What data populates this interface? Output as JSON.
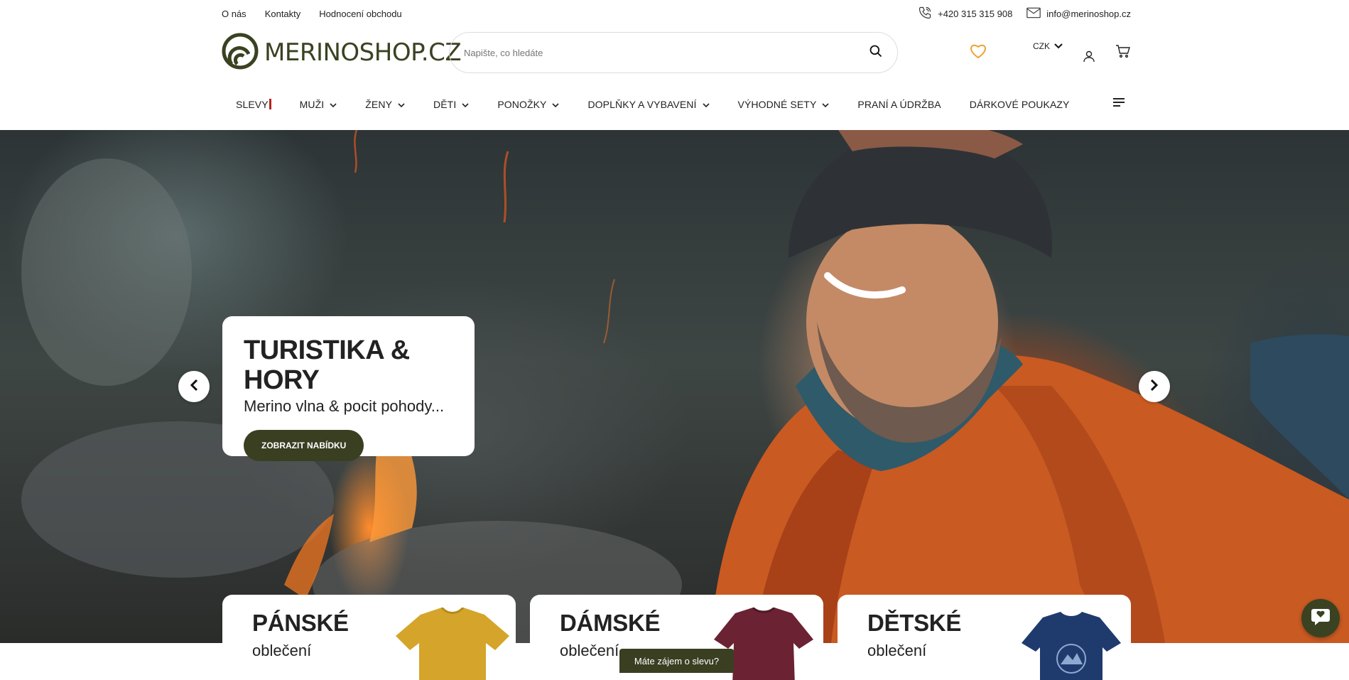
{
  "topbar": {
    "links": [
      "O nás",
      "Kontakty",
      "Hodnocení obchodu"
    ],
    "phone": "+420 315 315 908",
    "email": "info@merinoshop.cz"
  },
  "header": {
    "logo_text": "MERINOSHOP.CZ",
    "search_placeholder": "Napište, co hledáte",
    "currency": "CZK",
    "icons": [
      "search-icon",
      "heart-icon",
      "chevron-down-icon",
      "user-icon",
      "cart-icon"
    ],
    "accent_color": "#3a4221",
    "heart_color": "#f0a030"
  },
  "nav": {
    "items": [
      {
        "label": "SLEVY",
        "dropdown": false
      },
      {
        "label": "MUŽI",
        "dropdown": true
      },
      {
        "label": "ŽENY",
        "dropdown": true
      },
      {
        "label": "DĚTI",
        "dropdown": true
      },
      {
        "label": "PONOŽKY",
        "dropdown": true
      },
      {
        "label": "DOPLŇKY A VYBAVENÍ",
        "dropdown": true
      },
      {
        "label": "VÝHODNÉ SETY",
        "dropdown": true
      },
      {
        "label": "PRANÍ A ÚDRŽBA",
        "dropdown": false
      },
      {
        "label": "DÁRKOVÉ POUKAZY",
        "dropdown": false
      }
    ]
  },
  "hero": {
    "title": "TURISTIKA & HORY",
    "subtitle": "Merino vlna & pocit pohody...",
    "button": "ZOBRAZIT NABÍDKU"
  },
  "categories": [
    {
      "title": "PÁNSKÉ",
      "sub": "oblečení",
      "shirt_color": "#d4a52a"
    },
    {
      "title": "DÁMSKÉ",
      "sub": "oblečení",
      "shirt_color": "#6b2233"
    },
    {
      "title": "DĚTSKÉ",
      "sub": "oblečení",
      "shirt_color": "#1f3b6e"
    }
  ],
  "promo": "Máte zájem o slevu?"
}
